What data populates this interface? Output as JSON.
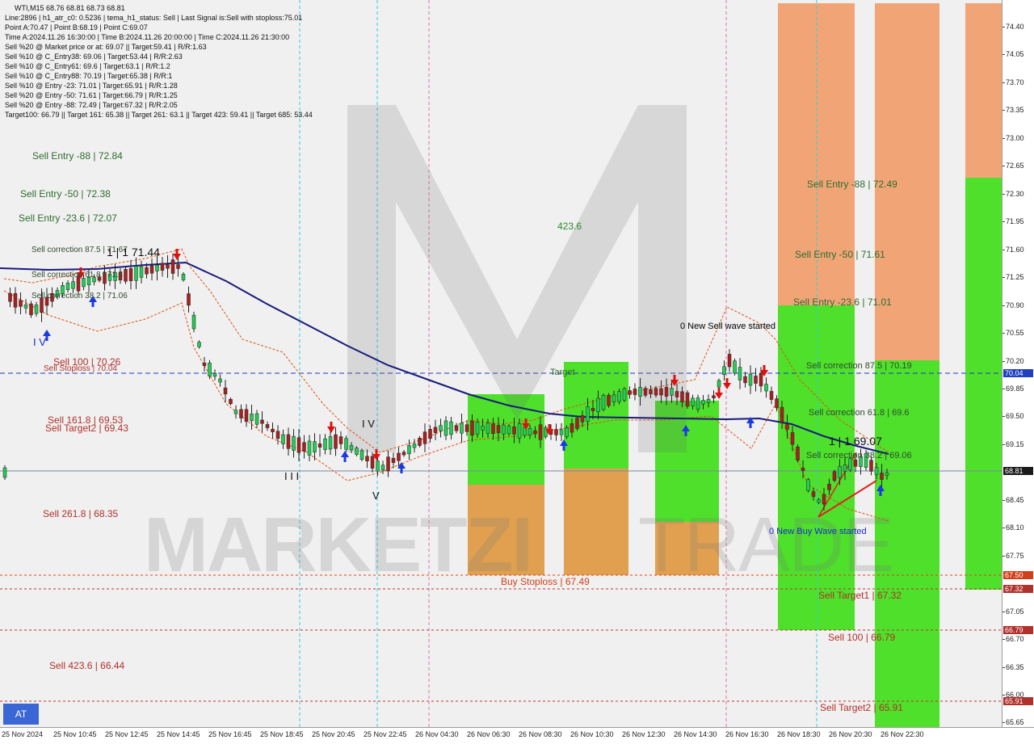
{
  "header": {
    "symbol_line": "WTI,M15  68.76 68.81 68.73 68.81",
    "info_lines": [
      "Line:2896 | h1_atr_c0: 0.5236 | tema_h1_status: Sell | Last Signal is:Sell with stoploss:75.01",
      "Point A:70.47 | Point B:68.19 | Point C:69.07",
      "Time A:2024.11.26 16:30:00 | Time B:2024.11.26 20:00:00 | Time C:2024.11.26 21:30:00",
      "Sell %20 @ Market price or at: 69.07 || Target:59.41 | R/R:1.63",
      "Sell %10 @ C_Entry38: 69.06 | Target:53.44 | R/R:2.63",
      "Sell %10 @ C_Entry61: 69.6 | Target:63.1 | R/R:1.2",
      "Sell %10 @ C_Entry88: 70.19 | Target:65.38 | R/R:1",
      "Sell %10 @ Entry -23: 71.01 | Target:65.91 | R/R:1.28",
      "Sell %20 @ Entry -50: 71.61 | Target:66.79 | R/R:1.25",
      "Sell %20 @ Entry -88: 72.49 | Target:67.32 | R/R:2.05",
      "Target100: 66.79 || Target 161: 65.38 || Target 261: 63.1 || Target 423: 59.41 || Target 685: 53.44"
    ]
  },
  "watermark": {
    "brand": "MARKETZI",
    "suffix": "TRADE"
  },
  "price_axis": {
    "ticks": [
      "74.40",
      "74.05",
      "73.70",
      "73.35",
      "73.00",
      "72.65",
      "72.30",
      "71.95",
      "71.60",
      "71.25",
      "70.90",
      "70.55",
      "70.20",
      "69.85",
      "69.50",
      "69.15",
      "68.81",
      "68.45",
      "68.10",
      "67.75",
      "67.50",
      "67.32",
      "67.05",
      "66.79",
      "66.70",
      "66.35",
      "66.00",
      "65.91",
      "65.65"
    ],
    "current_price": "68.81",
    "level_labels": [
      {
        "text": "70.04",
        "color": "#1f3fbf"
      },
      {
        "text": "67.50",
        "color": "#d0401a"
      },
      {
        "text": "67.32",
        "color": "#b0302a"
      },
      {
        "text": "66.79",
        "color": "#b0302a"
      },
      {
        "text": "65.91",
        "color": "#b0302a"
      }
    ]
  },
  "time_axis": {
    "ticks": [
      "25 Nov 2024",
      "25 Nov 10:45",
      "25 Nov 12:45",
      "25 Nov 14:45",
      "25 Nov 16:45",
      "25 Nov 18:45",
      "25 Nov 20:45",
      "25 Nov 22:45",
      "26 Nov 04:30",
      "26 Nov 06:30",
      "26 Nov 08:30",
      "26 Nov 10:30",
      "26 Nov 12:30",
      "26 Nov 14:30",
      "26 Nov 16:30",
      "26 Nov 18:30",
      "26 Nov 20:30",
      "26 Nov 22:30"
    ]
  },
  "left_labels": [
    {
      "text": "Sell Entry -88 | 72.84",
      "color": "#2e6b2e"
    },
    {
      "text": "Sell Entry -50 | 72.38",
      "color": "#2e6b2e"
    },
    {
      "text": "Sell Entry -23.6 | 72.07",
      "color": "#2e6b2e"
    },
    {
      "text": "Sell correction 87.5 | 71.67",
      "color": "#2e4a2e"
    },
    {
      "text": "Sell correction 61.8 | 71.4",
      "color": "#2e4a2e"
    },
    {
      "text": "Sell correction 38.2 | 71.06",
      "color": "#2e4a2e"
    },
    {
      "text": "Sell 100 | 70.26",
      "color": "#b0302a"
    },
    {
      "text": "Sell Stoploss | 70.04",
      "color": "#b0302a"
    },
    {
      "text": "Sell 161.8 | 69.53",
      "color": "#b0302a"
    },
    {
      "text": "Sell Target2 | 69.43",
      "color": "#b0302a"
    },
    {
      "text": "Sell 261.8 | 68.35",
      "color": "#b0302a"
    },
    {
      "text": "Sell 423.6 | 66.44",
      "color": "#b0302a"
    }
  ],
  "right_labels": [
    {
      "text": "Sell Entry -88 | 72.49",
      "color": "#2e6b2e"
    },
    {
      "text": "Sell Entry -50 | 71.61",
      "color": "#2e6b2e"
    },
    {
      "text": "Sell Entry -23.6 | 71.01",
      "color": "#2e6b2e"
    },
    {
      "text": "Sell correction 87.5 | 70.19",
      "color": "#2e4a2e"
    },
    {
      "text": "Sell correction 61.8 | 69.6",
      "color": "#2e4a2e"
    },
    {
      "text": "Sell correction 38.2 | 69.06",
      "color": "#2e4a2e"
    },
    {
      "text": "Sell Target1 | 67.32",
      "color": "#b0302a"
    },
    {
      "text": "Sell 100 | 66.79",
      "color": "#b0302a"
    },
    {
      "text": "Sell Target2 | 65.91",
      "color": "#b0302a"
    }
  ],
  "annotations": {
    "new_sell_wave": "0 New Sell wave started",
    "new_buy_wave": "0 New Buy Wave started",
    "buy_stoploss": "Buy Stoploss | 67.49",
    "level_423": "423.6",
    "point_c_label": "1 | 1 69.07",
    "point_left_label": "1 | 1 71.44",
    "roman_iv_left": "I V",
    "roman_iv_mid": "I V",
    "roman_v": "V",
    "roman_iii": "I I I",
    "target_small": "Target"
  },
  "ui": {
    "at_button": "AT"
  },
  "colors": {
    "green": "#3ee61c",
    "orange": "#f0a070",
    "red_line": "#c83020",
    "ma_line": "#1a1a7a",
    "stoploss_line": "#2035c0"
  }
}
